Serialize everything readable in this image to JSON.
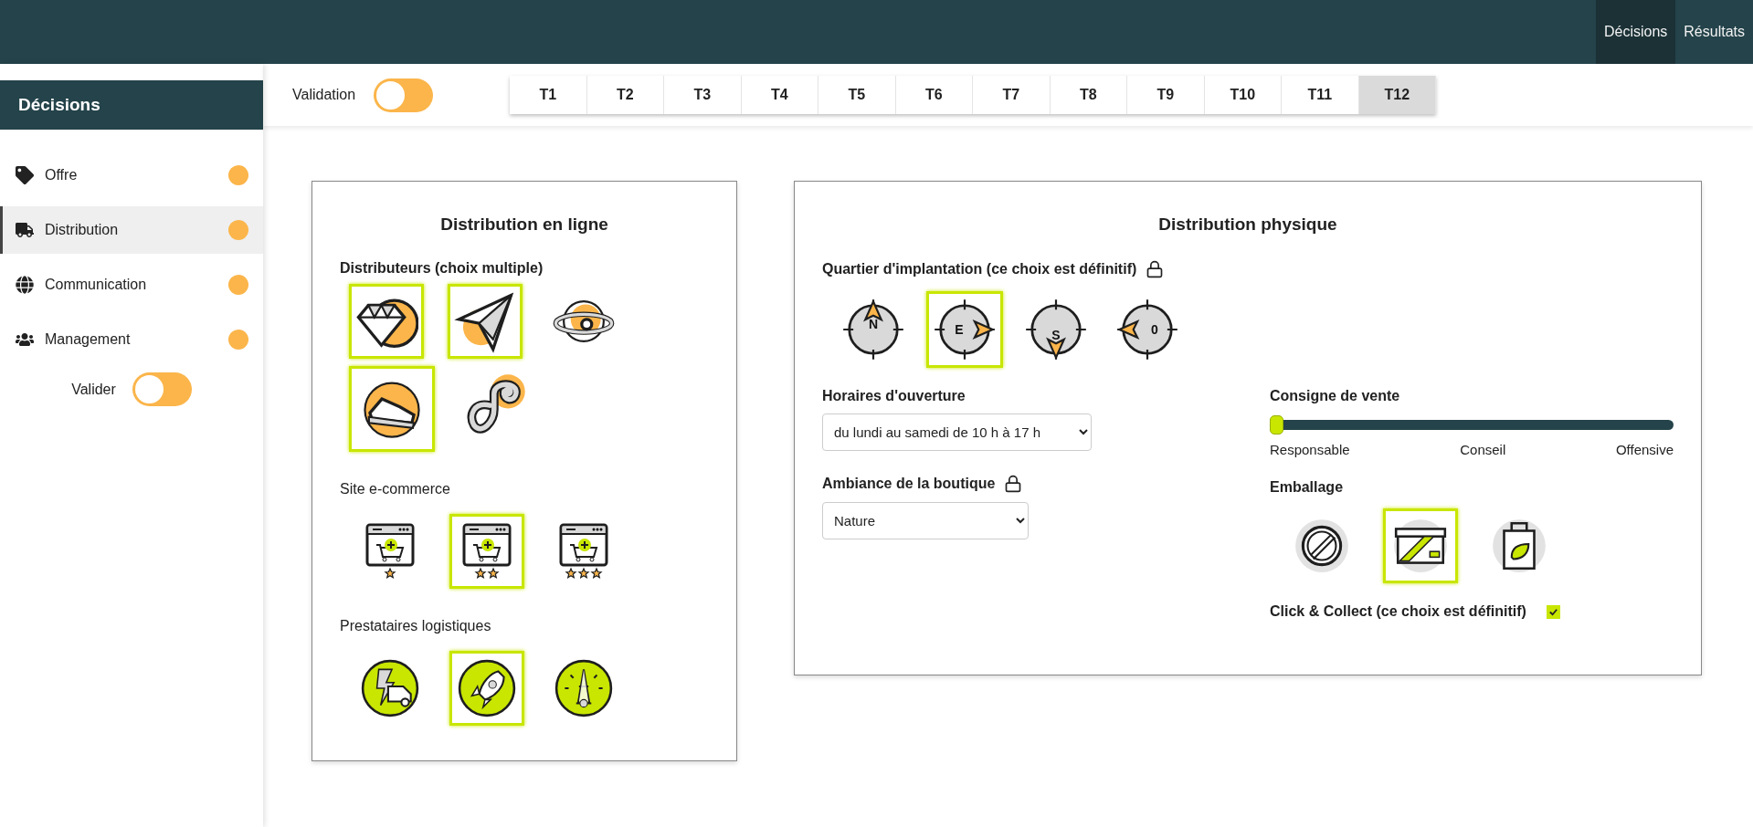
{
  "nav": [
    {
      "label": "Décisions",
      "selected": true
    },
    {
      "label": "Résultats",
      "selected": false
    }
  ],
  "sidebar": {
    "title": "Décisions",
    "items": [
      {
        "label": "Offre",
        "selected": false
      },
      {
        "label": "Distribution",
        "selected": true
      },
      {
        "label": "Communication",
        "selected": false
      },
      {
        "label": "Management",
        "selected": false
      }
    ],
    "validate": {
      "label": "Valider",
      "on": false
    }
  },
  "toolbar": {
    "validation": {
      "label": "Validation",
      "on": false
    },
    "tabs": [
      {
        "label": "T1",
        "selected": false
      },
      {
        "label": "T2",
        "selected": false
      },
      {
        "label": "T3",
        "selected": false
      },
      {
        "label": "T4",
        "selected": false
      },
      {
        "label": "T5",
        "selected": false
      },
      {
        "label": "T6",
        "selected": false
      },
      {
        "label": "T7",
        "selected": false
      },
      {
        "label": "T8",
        "selected": false
      },
      {
        "label": "T9",
        "selected": false
      },
      {
        "label": "T10",
        "selected": false
      },
      {
        "label": "T11",
        "selected": false
      },
      {
        "label": "T12",
        "selected": true
      }
    ]
  },
  "online": {
    "title": "Distribution en ligne",
    "distributors": {
      "label": "Distributeurs (choix multiple)",
      "options": [
        {
          "selected": true
        },
        {
          "selected": true
        },
        {
          "selected": false
        },
        {
          "selected": true
        },
        {
          "selected": false
        }
      ]
    },
    "ecommerce": {
      "label": "Site e-commerce",
      "options": [
        {
          "selected": false
        },
        {
          "selected": true
        },
        {
          "selected": false
        }
      ]
    },
    "logistics": {
      "label": "Prestataires logistiques",
      "options": [
        {
          "selected": false
        },
        {
          "selected": true
        },
        {
          "selected": false
        }
      ]
    }
  },
  "physical": {
    "title": "Distribution physique",
    "district": {
      "label": "Quartier d'implantation (ce choix est définitif)",
      "options": [
        {
          "letter": "N",
          "selected": false
        },
        {
          "letter": "E",
          "selected": true
        },
        {
          "letter": "S",
          "selected": false
        },
        {
          "letter": "0",
          "selected": false
        }
      ]
    },
    "hours": {
      "label": "Horaires d'ouverture",
      "value": "du lundi au samedi de 10 h à 17 h"
    },
    "ambiance": {
      "label": "Ambiance de la boutique",
      "value": "Nature"
    },
    "sales": {
      "label": "Consigne de vente",
      "level": 0,
      "marks": [
        "Responsable",
        "Conseil",
        "Offensive"
      ]
    },
    "packaging": {
      "label": "Emballage",
      "options": [
        {
          "selected": false
        },
        {
          "selected": true
        },
        {
          "selected": false
        }
      ]
    },
    "click_collect": {
      "label": "Click & Collect (ce choix est définitif)",
      "checked": true
    }
  }
}
